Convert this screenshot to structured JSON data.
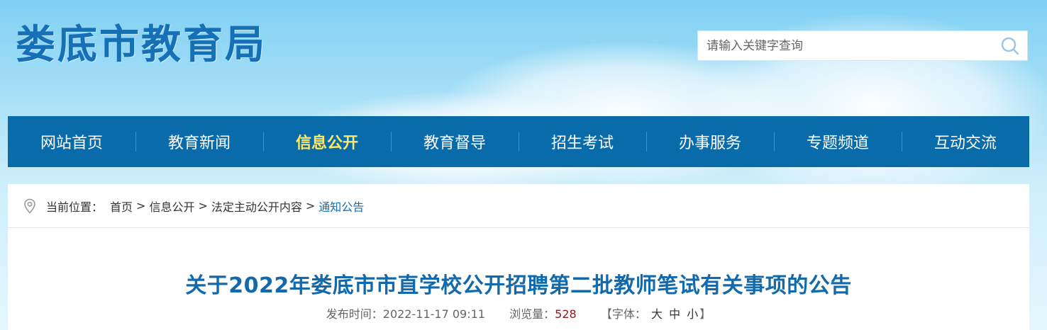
{
  "header": {
    "site_title": "娄底市教育局",
    "search": {
      "placeholder": "请输入关键字查询",
      "value": ""
    }
  },
  "nav": {
    "items": [
      {
        "label": "网站首页",
        "active": false
      },
      {
        "label": "教育新闻",
        "active": false
      },
      {
        "label": "信息公开",
        "active": true
      },
      {
        "label": "教育督导",
        "active": false
      },
      {
        "label": "招生考试",
        "active": false
      },
      {
        "label": "办事服务",
        "active": false
      },
      {
        "label": "专题频道",
        "active": false
      },
      {
        "label": "互动交流",
        "active": false
      }
    ]
  },
  "breadcrumb": {
    "label": "当前位置：",
    "items": [
      "首页",
      "信息公开",
      "法定主动公开内容",
      "通知公告"
    ],
    "separator": ">"
  },
  "article": {
    "title": "关于2022年娄底市市直学校公开招聘第二批教师笔试有关事项的公告",
    "publish_label": "发布时间：",
    "publish_time": "2022-11-17 09:11",
    "views_label": "浏览量：",
    "views": "528",
    "font_label_open": "【字体：",
    "font_large": "大",
    "font_medium": "中",
    "font_small": "小",
    "font_label_close": "】"
  },
  "colors": {
    "brand_blue": "#1570b5",
    "nav_bg": "#0a6bab",
    "nav_active": "#ffe866",
    "title_blue": "#1269ac",
    "views_red": "#8b1a1a"
  },
  "icons": {
    "search": "search-icon",
    "location": "location-pin-icon"
  }
}
